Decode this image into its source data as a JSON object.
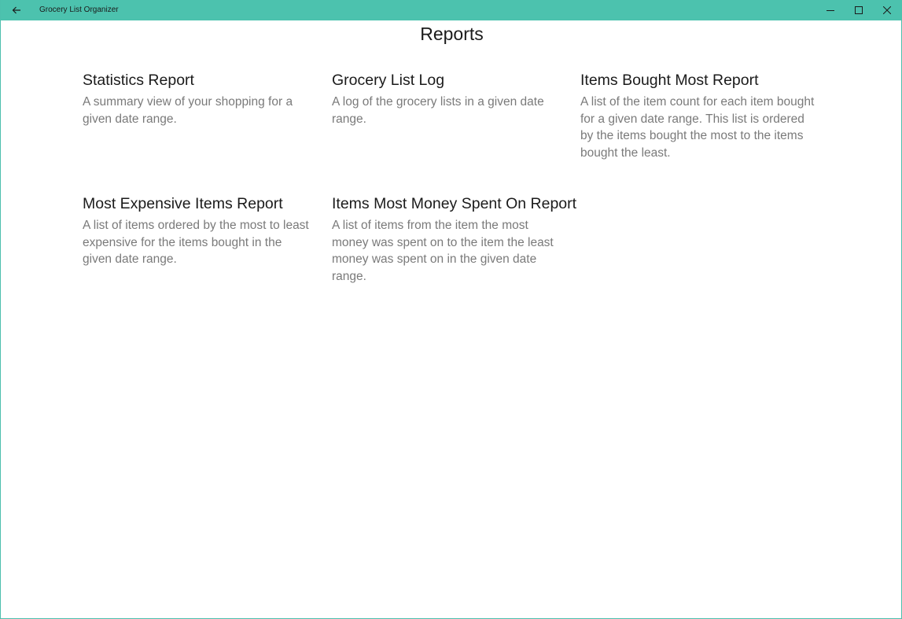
{
  "titlebar": {
    "app_title": "Grocery List Organizer",
    "back_icon": "arrow-left-icon",
    "minimize_icon": "minimize-icon",
    "maximize_icon": "maximize-icon",
    "close_icon": "close-icon"
  },
  "page": {
    "title": "Reports"
  },
  "reports": [
    {
      "title": "Statistics Report",
      "description": "A summary view of your shopping for a given date range."
    },
    {
      "title": "Grocery List Log",
      "description": "A log of the grocery lists in a given date range."
    },
    {
      "title": "Items Bought Most Report",
      "description": "A list of the item count for each item bought for a given date range. This list is ordered by the items bought the most to the items bought the least."
    },
    {
      "title": "Most Expensive Items Report",
      "description": "A list of items ordered by the most to least expensive for the items bought in the given date range."
    },
    {
      "title": "Items Most Money Spent On Report",
      "description": "A list of items from the item the most money was spent on to the item the least money was spent on in the given date range."
    }
  ],
  "colors": {
    "accent": "#4cc2ae",
    "title_text": "#1b1b1b",
    "description_text": "#7a7a7a"
  }
}
